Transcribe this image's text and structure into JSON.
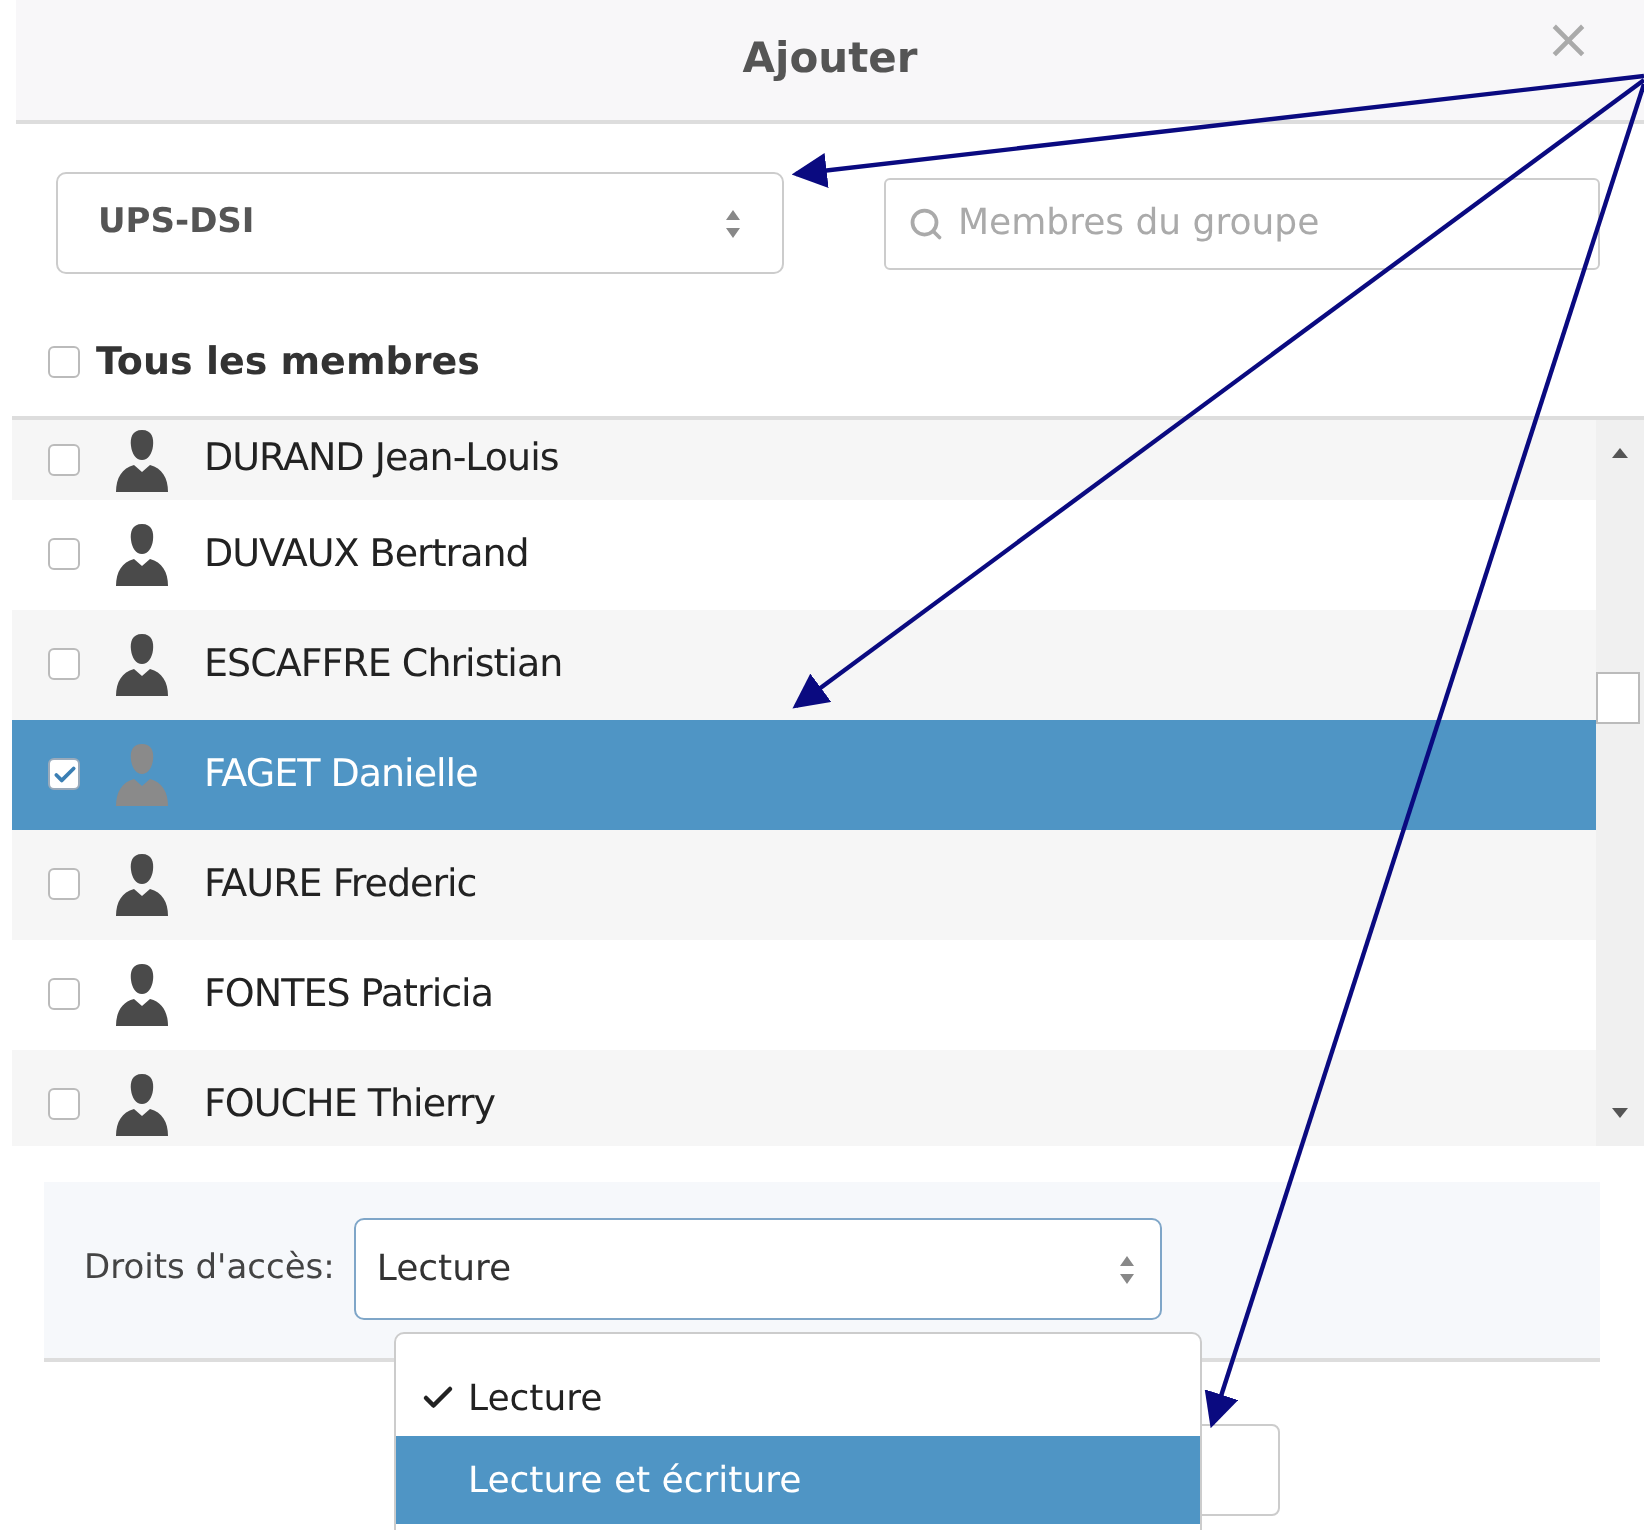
{
  "dialog": {
    "title": "Ajouter",
    "close": "×"
  },
  "group_select": {
    "value": "UPS-DSI"
  },
  "search": {
    "placeholder": "Membres du groupe"
  },
  "all_members": {
    "label": "Tous les membres",
    "checked": false
  },
  "members": [
    {
      "name": "DURAND Jean-Louis",
      "checked": false,
      "selected": false
    },
    {
      "name": "DUVAUX Bertrand",
      "checked": false,
      "selected": false
    },
    {
      "name": "ESCAFFRE Christian",
      "checked": false,
      "selected": false
    },
    {
      "name": "FAGET Danielle",
      "checked": true,
      "selected": true
    },
    {
      "name": "FAURE Frederic",
      "checked": false,
      "selected": false
    },
    {
      "name": "FONTES Patricia",
      "checked": false,
      "selected": false
    },
    {
      "name": "FOUCHE Thierry",
      "checked": false,
      "selected": false
    }
  ],
  "access": {
    "label": "Droits d'accès:",
    "value": "Lecture"
  },
  "access_menu": [
    {
      "label": "Lecture",
      "checked": true,
      "selected": false
    },
    {
      "label": "Lecture et écriture",
      "checked": false,
      "selected": true
    }
  ]
}
